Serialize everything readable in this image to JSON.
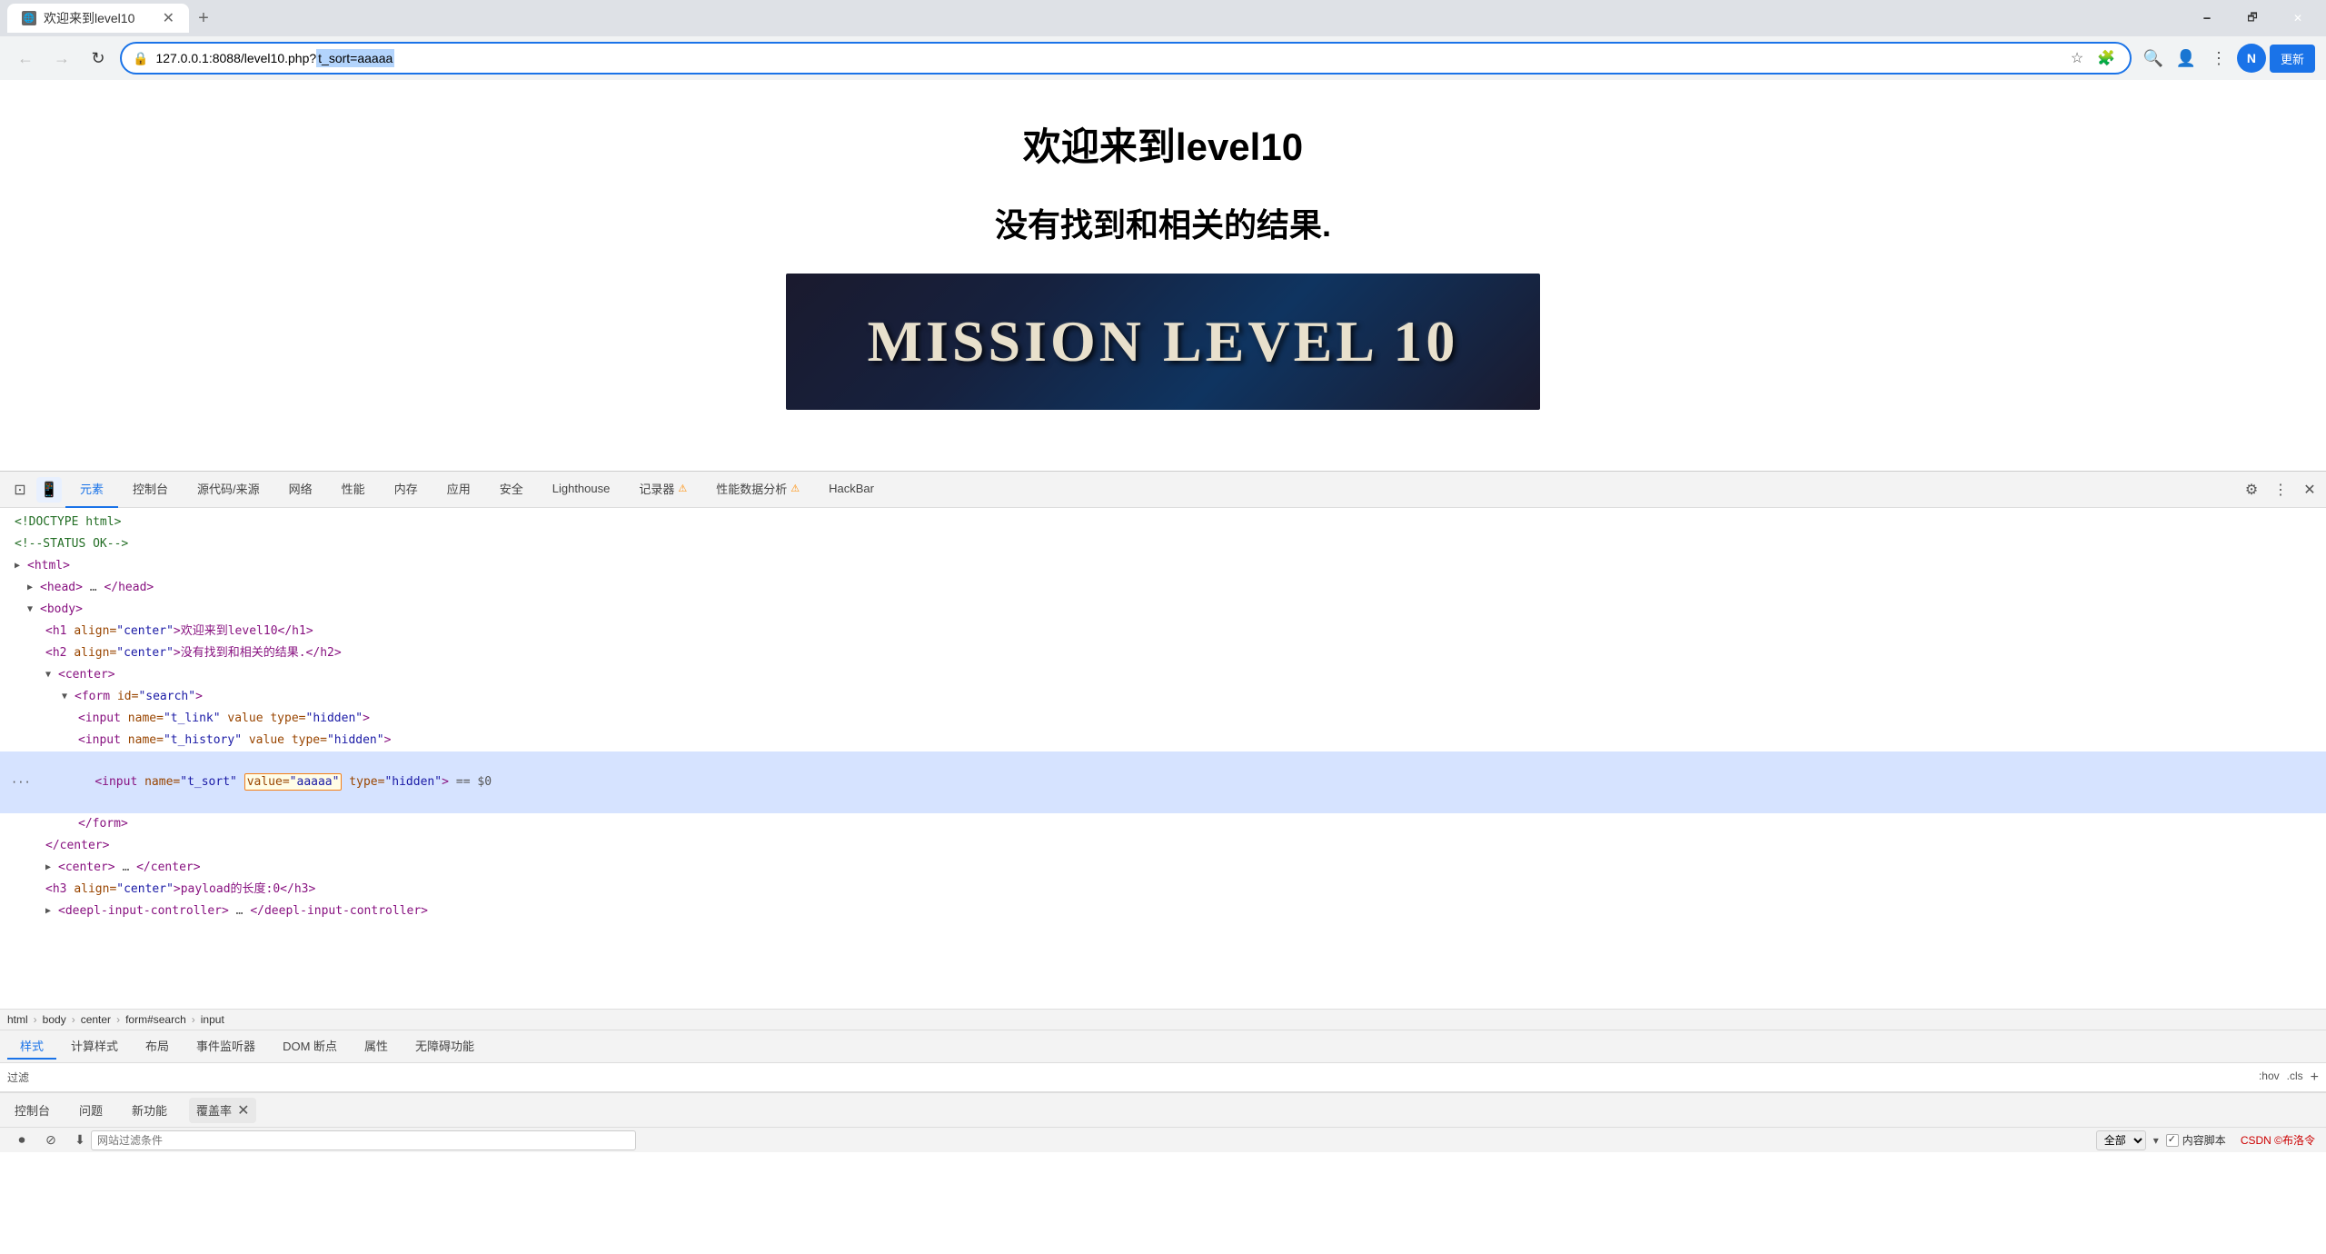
{
  "browser": {
    "tab_label": "欢迎来到level10",
    "new_tab_icon": "+",
    "url": "127.0.0.1:8088/level10.php?",
    "url_highlight": "t_sort=aaaaa",
    "update_btn": "更新",
    "win_min": "🗕",
    "win_restore": "🗗",
    "win_close": "✕"
  },
  "page": {
    "title": "欢迎来到level10",
    "subtitle": "没有找到和相关的结果.",
    "mission_text": "Mission Level 10"
  },
  "devtools": {
    "tabs": [
      {
        "id": "elements",
        "label": "元素",
        "active": true,
        "warn": false
      },
      {
        "id": "console",
        "label": "控制台",
        "active": false,
        "warn": false
      },
      {
        "id": "sources",
        "label": "源代码/来源",
        "active": false,
        "warn": false
      },
      {
        "id": "network",
        "label": "网络",
        "active": false,
        "warn": false
      },
      {
        "id": "performance",
        "label": "性能",
        "active": false,
        "warn": false
      },
      {
        "id": "memory",
        "label": "内存",
        "active": false,
        "warn": false
      },
      {
        "id": "application",
        "label": "应用",
        "active": false,
        "warn": false
      },
      {
        "id": "security",
        "label": "安全",
        "active": false,
        "warn": false
      },
      {
        "id": "lighthouse",
        "label": "Lighthouse",
        "active": false,
        "warn": false
      },
      {
        "id": "recorder",
        "label": "记录器",
        "active": false,
        "warn": true
      },
      {
        "id": "perf-insights",
        "label": "性能数据分析",
        "active": false,
        "warn": true
      },
      {
        "id": "hackbar",
        "label": "HackBar",
        "active": false,
        "warn": false
      }
    ],
    "dom_lines": [
      {
        "indent": 0,
        "content": "<!DOCTYPE html>",
        "type": "comment",
        "highlighted": false
      },
      {
        "indent": 0,
        "content": "<!--STATUS OK-->",
        "type": "comment",
        "highlighted": false
      },
      {
        "indent": 0,
        "content": "<html>",
        "type": "tag",
        "highlighted": false
      },
      {
        "indent": 1,
        "content": "<head> … </head>",
        "type": "collapsed",
        "highlighted": false
      },
      {
        "indent": 1,
        "content": "<body>",
        "type": "tag",
        "highlighted": false
      },
      {
        "indent": 2,
        "content": "<h1 align=\"center\">欢迎来到level10</h1>",
        "type": "tag",
        "highlighted": false
      },
      {
        "indent": 2,
        "content": "<h2 align=\"center\">没有找到和相关的结果.</h2>",
        "type": "tag",
        "highlighted": false
      },
      {
        "indent": 2,
        "content": "<center>",
        "type": "tag",
        "highlighted": false
      },
      {
        "indent": 3,
        "content": "<form id=\"search\">",
        "type": "tag",
        "highlighted": false
      },
      {
        "indent": 4,
        "content": "<input name=\"t_link\" value type=\"hidden\">",
        "type": "tag",
        "highlighted": false
      },
      {
        "indent": 4,
        "content": "<input name=\"t_history\" value type=\"hidden\">",
        "type": "tag",
        "highlighted": false
      },
      {
        "indent": 4,
        "content": "<input name=\"t_sort\" value=\"aaaaa\" type=\"hidden\"> == $0",
        "type": "tag",
        "highlighted": true
      },
      {
        "indent": 3,
        "content": "</form>",
        "type": "tag",
        "highlighted": false
      },
      {
        "indent": 2,
        "content": "</center>",
        "type": "tag",
        "highlighted": false
      },
      {
        "indent": 2,
        "content": "<center> … </center>",
        "type": "collapsed",
        "highlighted": false
      },
      {
        "indent": 2,
        "content": "<h3 align=\"center\">payload的长度:0</h3>",
        "type": "tag",
        "highlighted": false
      },
      {
        "indent": 2,
        "content": "<deepl-input-controller> … </deepl-input-controller>",
        "type": "collapsed",
        "highlighted": false
      }
    ],
    "breadcrumb": [
      "html",
      "body",
      "center",
      "form#search",
      "input"
    ],
    "style_tabs": [
      "样式",
      "计算样式",
      "布局",
      "事件监听器",
      "DOM 断点",
      "属性",
      "无障碍功能"
    ],
    "active_style_tab": "样式",
    "filter_placeholder": "过滤",
    "filter_actions": [
      ":hov",
      ".cls",
      "+"
    ],
    "bottom_tabs": [
      "控制台",
      "问题",
      "新功能",
      "覆盖率"
    ],
    "active_bottom_tab": "覆盖率",
    "status_filter_placeholder": "网站过滤条件",
    "status_select": "全部",
    "content_script_label": "内容脚本",
    "csdn_text": "CSDN ©布洛令"
  }
}
